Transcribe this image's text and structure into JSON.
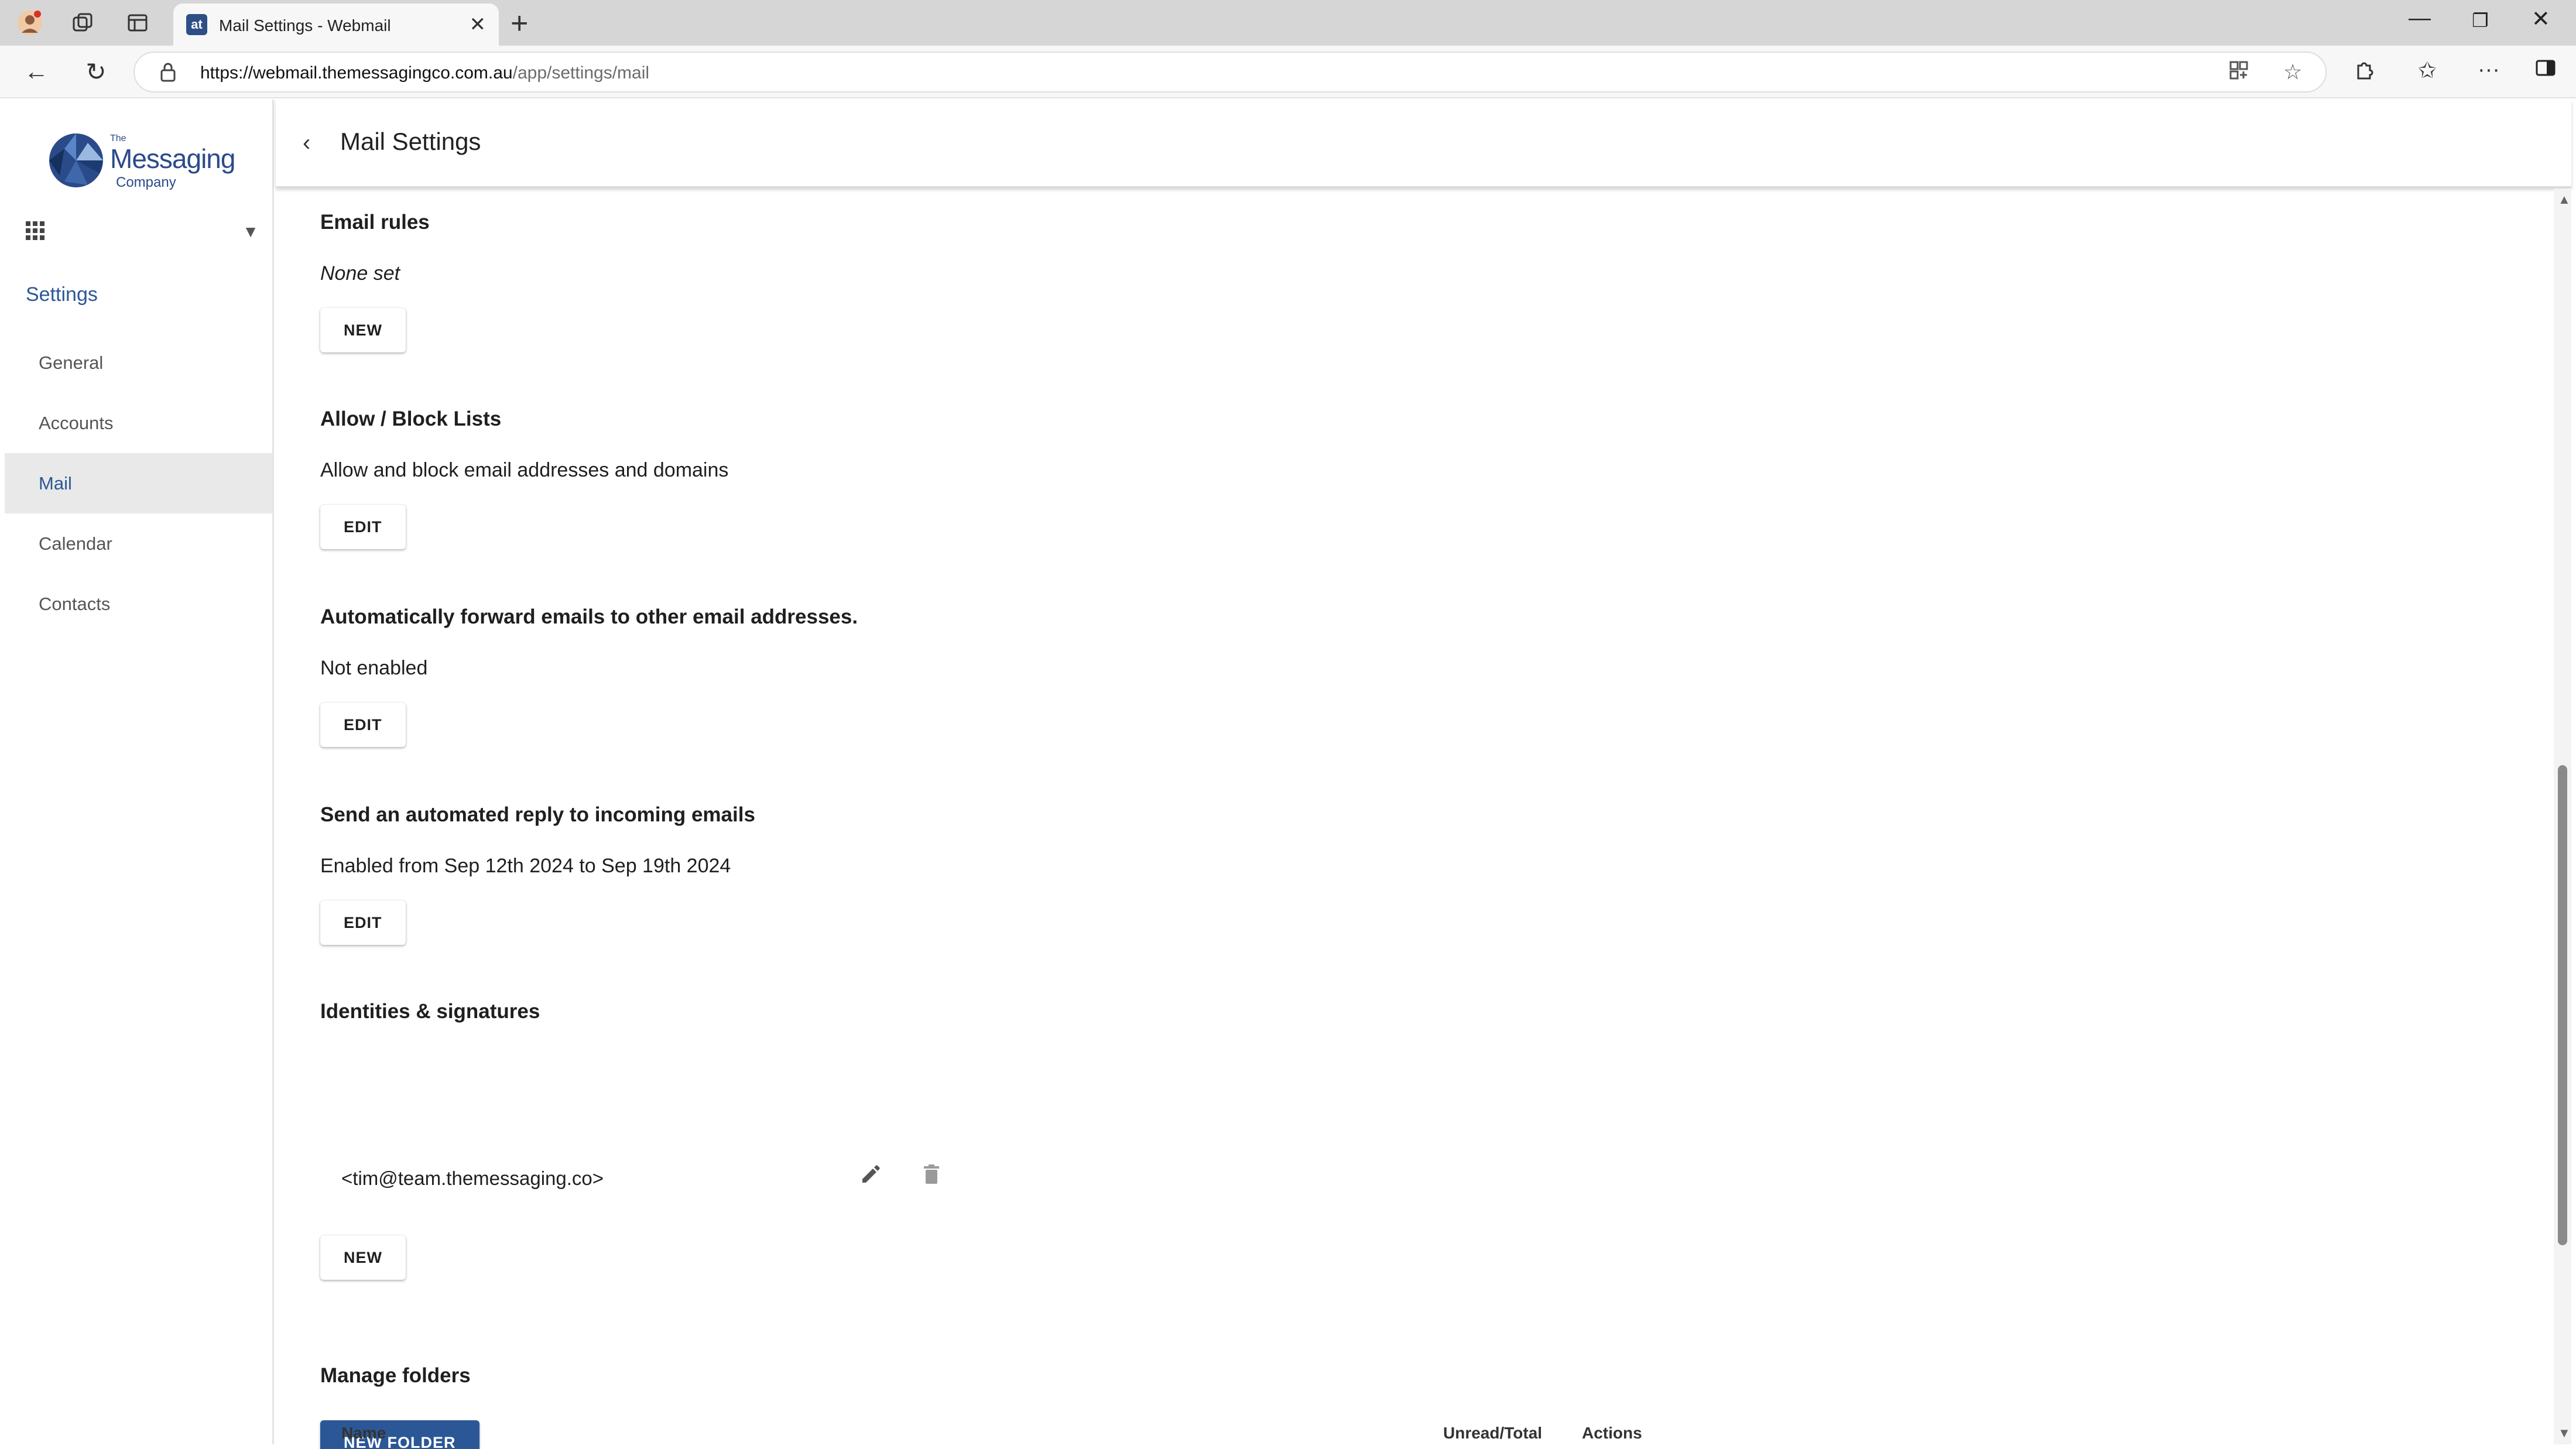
{
  "browser": {
    "tab_title": "Mail Settings - Webmail",
    "tab_favicon": "at",
    "url_host": "https://webmail.themessagingco.com.au",
    "url_path": "/app/settings/mail"
  },
  "sidebar": {
    "logo": {
      "the": "The",
      "messaging": "Messaging",
      "company": "Company"
    },
    "heading": "Settings",
    "items": [
      {
        "label": "General"
      },
      {
        "label": "Accounts"
      },
      {
        "label": "Mail"
      },
      {
        "label": "Calendar"
      },
      {
        "label": "Contacts"
      }
    ],
    "active_item": "Mail"
  },
  "header": {
    "title": "Mail Settings"
  },
  "sections": {
    "email_rules": {
      "title": "Email rules",
      "status": "None set",
      "button": "NEW"
    },
    "allow_block": {
      "title": "Allow / Block Lists",
      "description": "Allow and block email addresses and domains",
      "button": "EDIT"
    },
    "forward": {
      "title": "Automatically forward emails to other email addresses.",
      "status": "Not enabled",
      "button": "EDIT"
    },
    "auto_reply": {
      "title": "Send an automated reply to incoming emails",
      "status": "Enabled from Sep 12th 2024 to Sep 19th 2024",
      "button": "EDIT"
    },
    "identities": {
      "title": "Identities & signatures",
      "entry": "<tim@team.themessaging.co>",
      "button": "NEW"
    },
    "folders": {
      "title": "Manage folders",
      "button": "NEW FOLDER",
      "columns": [
        "Name",
        "Unread/Total",
        "Actions"
      ]
    }
  },
  "colors": {
    "accent": "#2b5797",
    "active_bg": "#e9e9e9",
    "titlebar": "#d6d6d6"
  }
}
